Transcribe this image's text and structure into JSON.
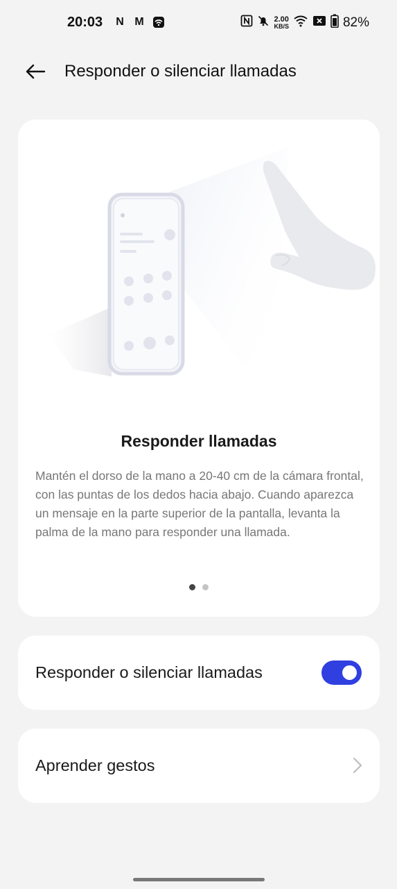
{
  "status_bar": {
    "time": "20:03",
    "left_icons": [
      "netflix-icon",
      "mail-m-icon",
      "wifi-box-icon"
    ],
    "left_glyphs": [
      "N",
      "M",
      "≋"
    ],
    "net_speed_value": "2.00",
    "net_speed_unit": "KB/S",
    "battery": "82%"
  },
  "app_bar": {
    "title": "Responder o silenciar llamadas"
  },
  "illustration_card": {
    "heading": "Responder llamadas",
    "description": "Mantén el dorso de la mano a 20-40 cm de la cámara frontal, con las puntas de los dedos hacia abajo. Cuando aparezca un mensaje en la parte superior de la pantalla, levanta la palma de la mano para responder una llamada.",
    "pages": 2,
    "active_page": 1
  },
  "toggle_card": {
    "label": "Responder o silenciar llamadas",
    "enabled": true,
    "accent": "#2f3fe0"
  },
  "gestures_card": {
    "label": "Aprender gestos"
  }
}
